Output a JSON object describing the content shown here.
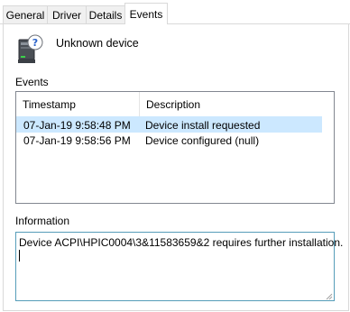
{
  "tabs": [
    {
      "label": "General"
    },
    {
      "label": "Driver"
    },
    {
      "label": "Details"
    },
    {
      "label": "Events"
    }
  ],
  "device": {
    "name": "Unknown device",
    "icon": "unknown-device-icon"
  },
  "events": {
    "label": "Events",
    "columns": [
      "Timestamp",
      "Description"
    ],
    "rows": [
      {
        "timestamp": "07-Jan-19 9:58:48 PM",
        "description": "Device install requested",
        "selected": true
      },
      {
        "timestamp": "07-Jan-19 9:58:56 PM",
        "description": "Device configured (null)",
        "selected": false
      }
    ]
  },
  "information": {
    "label": "Information",
    "text": "Device ACPI\\HPIC0004\\3&11583659&2 requires further installation."
  },
  "colors": {
    "selection": "#cce8ff",
    "info_border": "#569db9",
    "tab_inactive": "#f0f0f0"
  }
}
